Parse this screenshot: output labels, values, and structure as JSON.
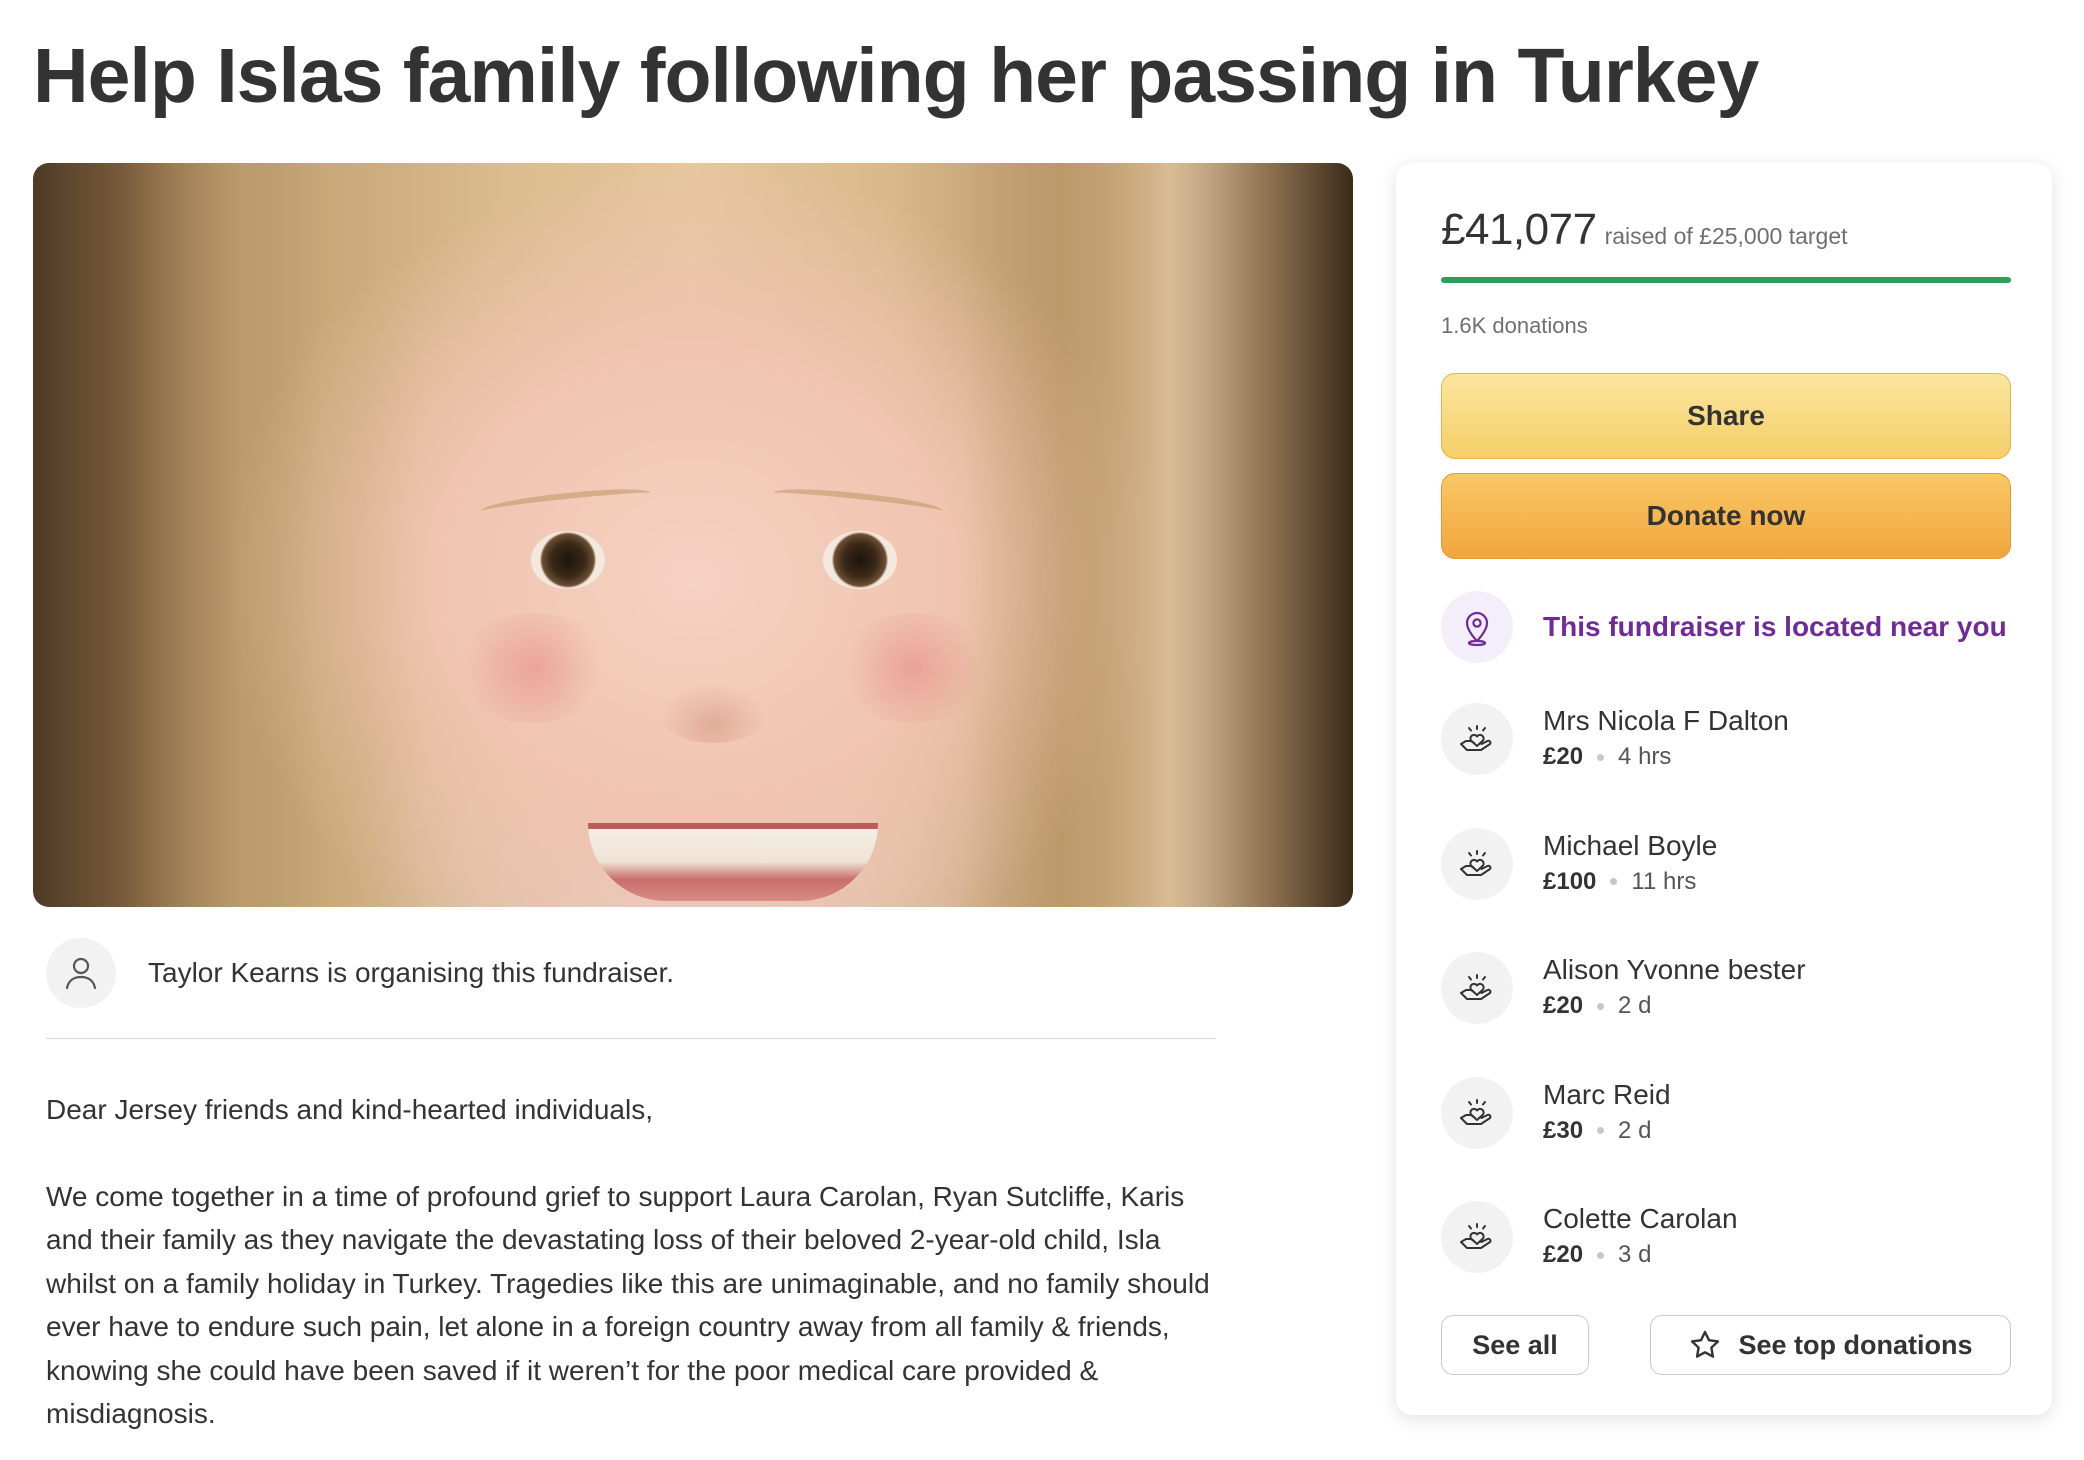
{
  "title": "Help Islas family following her passing in Turkey",
  "organiser": {
    "text": "Taylor Kearns is organising this fundraiser."
  },
  "story": {
    "paragraphs": [
      "Dear Jersey friends and kind-hearted individuals,",
      "We come together in a time of profound grief to support Laura Carolan, Ryan Sutcliffe, Karis and their family as they navigate the devastating loss of their beloved 2-year-old child, Isla whilst on a family holiday in Turkey. Tragedies like this are unimaginable, and no family should ever have to endure such pain, let alone in a foreign country away from all family & friends, knowing she could have been saved if it weren’t for the poor medical care provided & misdiagnosis."
    ]
  },
  "sidebar": {
    "raised": "£41,077",
    "target_text": "raised of £25,000 target",
    "progress_fraction": 1.0,
    "progress_color": "#2e9e5b",
    "donation_count": "1.6K donations",
    "share_label": "Share",
    "donate_label": "Donate now",
    "nearby_text": "This fundraiser is located near you",
    "nearby_icon": "location-pin-icon",
    "donors": [
      {
        "name": "Mrs Nicola F Dalton",
        "amount": "£20",
        "time": "4 hrs"
      },
      {
        "name": "Michael Boyle",
        "amount": "£100",
        "time": "11 hrs"
      },
      {
        "name": "Alison Yvonne bester",
        "amount": "£20",
        "time": "2 d"
      },
      {
        "name": "Marc Reid",
        "amount": "£30",
        "time": "2 d"
      },
      {
        "name": "Colette Carolan",
        "amount": "£20",
        "time": "3 d"
      }
    ],
    "donor_icon": "heart-hand-icon",
    "see_all_label": "See all",
    "see_top_label": "See top donations"
  },
  "colors": {
    "accent_purple": "#6f2b99",
    "share_yellow": "#f5cf68",
    "donate_orange": "#f2a53c"
  }
}
